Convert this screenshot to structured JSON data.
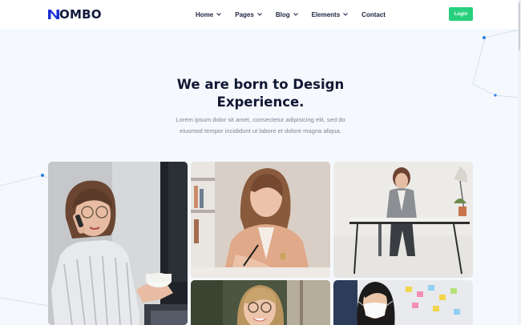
{
  "brand": {
    "name": "OMBO",
    "accent_color": "#1a2fd6",
    "cta_color": "#27d07c"
  },
  "nav": {
    "items": [
      {
        "label": "Home",
        "has_dropdown": true
      },
      {
        "label": "Pages",
        "has_dropdown": true
      },
      {
        "label": "Blog",
        "has_dropdown": true
      },
      {
        "label": "Elements",
        "has_dropdown": true
      },
      {
        "label": "Contact",
        "has_dropdown": false
      }
    ],
    "login_label": "Login"
  },
  "hero": {
    "title_line1": "We are born to Design",
    "title_line2": "Experience.",
    "subtitle_line1": "Lorem ipsum dolor sit amet, consectetur adipisicing elit, sed do",
    "subtitle_line2": "eiusmod tempor incididunt ut labore et dolore magna aliqua."
  },
  "gallery": {
    "photos": [
      {
        "subject": "woman on phone holding coffee cup"
      },
      {
        "subject": "woman in blazer writing at desk"
      },
      {
        "subject": "woman sitting at office desk"
      },
      {
        "subject": "smiling woman with glasses"
      },
      {
        "subject": "woman wearing face mask"
      }
    ]
  }
}
